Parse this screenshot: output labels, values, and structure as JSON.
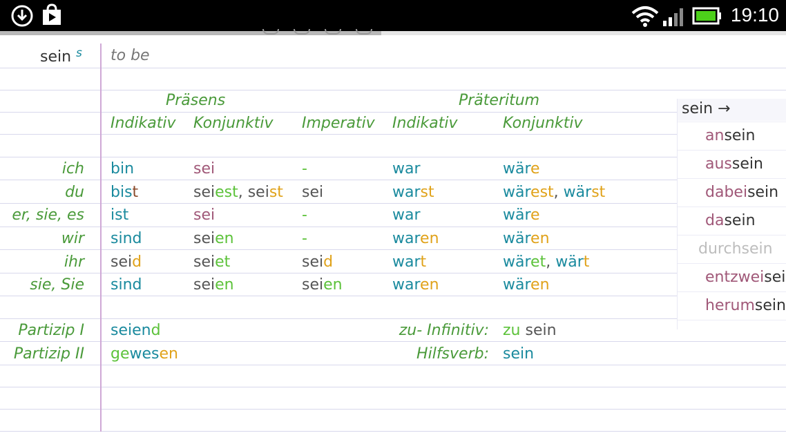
{
  "status_bar": {
    "time": "19:10",
    "icons": [
      "download-icon",
      "play-store-icon",
      "wifi-icon",
      "signal-icon",
      "battery-icon"
    ]
  },
  "entry": {
    "headword": "sein",
    "headword_tag": "s",
    "translation": "to be"
  },
  "headers": {
    "praesens": "Präsens",
    "praeteritum": "Präteritum",
    "praesens_indikativ": "Indikativ",
    "praesens_konjunktiv": "Konjunktiv",
    "imperativ": "Imperativ",
    "praeteritum_indikativ": "Indikativ",
    "praeteritum_konjunktiv": "Konjunktiv"
  },
  "pronouns": [
    "ich",
    "du",
    "er, sie, es",
    "wir",
    "ihr",
    "sie, Sie"
  ],
  "forms": {
    "r0": {
      "pi": "bin",
      "pk": "sei",
      "imp": "-",
      "ti": "war",
      "tk_a": "wär",
      "tk_b": "e"
    },
    "r1": {
      "pi_a": "bis",
      "pi_b": "t",
      "pk_a": "sei",
      "pk_b": "est",
      "pk_c": ", sei",
      "pk_d": "st",
      "imp": "sei",
      "ti_a": "war",
      "ti_b": "st",
      "tk_a": "wär",
      "tk_b": "est",
      "tk_c": ", ",
      "tk_d": "wär",
      "tk_e": "st"
    },
    "r2": {
      "pi": "ist",
      "pk": "sei",
      "imp": "-",
      "ti": "war",
      "tk_a": "wär",
      "tk_b": "e"
    },
    "r3": {
      "pi": "sind",
      "pk_a": "sei",
      "pk_b": "en",
      "imp": "-",
      "ti_a": "war",
      "ti_b": "en",
      "tk_a": "wär",
      "tk_b": "en"
    },
    "r4": {
      "pi_a": "sei",
      "pi_b": "d",
      "pk_a": "sei",
      "pk_b": "et",
      "imp_a": "sei",
      "imp_b": "d",
      "ti_a": "war",
      "ti_b": "t",
      "tk_a": "wär",
      "tk_b": "et",
      "tk_c": ", ",
      "tk_d": "wär",
      "tk_e": "t"
    },
    "r5": {
      "pi": "sind",
      "pk_a": "sei",
      "pk_b": "en",
      "imp_a": "sei",
      "imp_b": "en",
      "ti_a": "war",
      "ti_b": "en",
      "tk_a": "wär",
      "tk_b": "en"
    }
  },
  "participles": {
    "p1_label": "Partizip I",
    "p1_a": "seien",
    "p1_b": "d",
    "p2_label": "Partizip II",
    "p2_a": "ge",
    "p2_b": "wes",
    "p2_c": "en",
    "zu_label": "zu- Infinitiv:",
    "zu_a": "zu",
    "zu_b": " sein",
    "aux_label": "Hilfsverb:",
    "aux_value": "sein"
  },
  "suggestions": {
    "header": "sein →",
    "items": [
      {
        "prefix": "an",
        "rest": "sein"
      },
      {
        "prefix": "aus",
        "rest": "sein"
      },
      {
        "prefix": "dabei",
        "rest": "sein"
      },
      {
        "prefix": "da",
        "rest": "sein"
      },
      {
        "full": "durchsein"
      },
      {
        "prefix": "entzwei",
        "rest": "sei"
      },
      {
        "prefix": "herum",
        "rest": "sein"
      }
    ]
  },
  "colors": {
    "label_green": "#4a9a3a",
    "stem_teal": "#1a8a9e",
    "ending_orange": "#e0a21a",
    "ending_green": "#5cc23a",
    "subjunctive_mauve": "#a05878"
  }
}
